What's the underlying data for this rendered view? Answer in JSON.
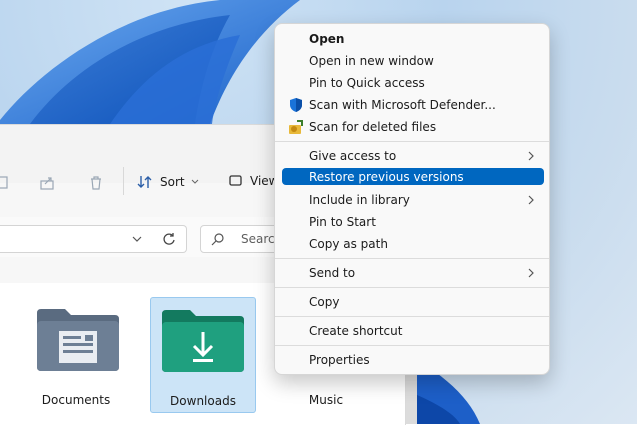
{
  "toolbar": {
    "sort_label": "Sort",
    "view_label": "View"
  },
  "address": {
    "search_placeholder": "Search"
  },
  "folders": [
    {
      "label": "Documents",
      "selected": false
    },
    {
      "label": "Downloads",
      "selected": true
    },
    {
      "label": "Music",
      "selected": false
    }
  ],
  "context_menu": {
    "items": [
      {
        "label": "Open"
      },
      {
        "label": "Open in new window"
      },
      {
        "label": "Pin to Quick access"
      },
      {
        "label": "Scan with Microsoft Defender...",
        "icon": "shield-icon"
      },
      {
        "label": "Scan for deleted files",
        "icon": "recovery-icon"
      },
      {
        "label": "Give access to",
        "submenu": true
      },
      {
        "label": "Restore previous versions",
        "highlighted": true
      },
      {
        "label": "Include in library",
        "submenu": true
      },
      {
        "label": "Pin to Start"
      },
      {
        "label": "Copy as path"
      },
      {
        "label": "Send to",
        "submenu": true
      },
      {
        "label": "Copy"
      },
      {
        "label": "Create shortcut"
      },
      {
        "label": "Properties"
      }
    ]
  },
  "colors": {
    "accent": "#0067c0",
    "downloads_folder": "#1fa07f",
    "documents_folder": "#6d7f95"
  }
}
